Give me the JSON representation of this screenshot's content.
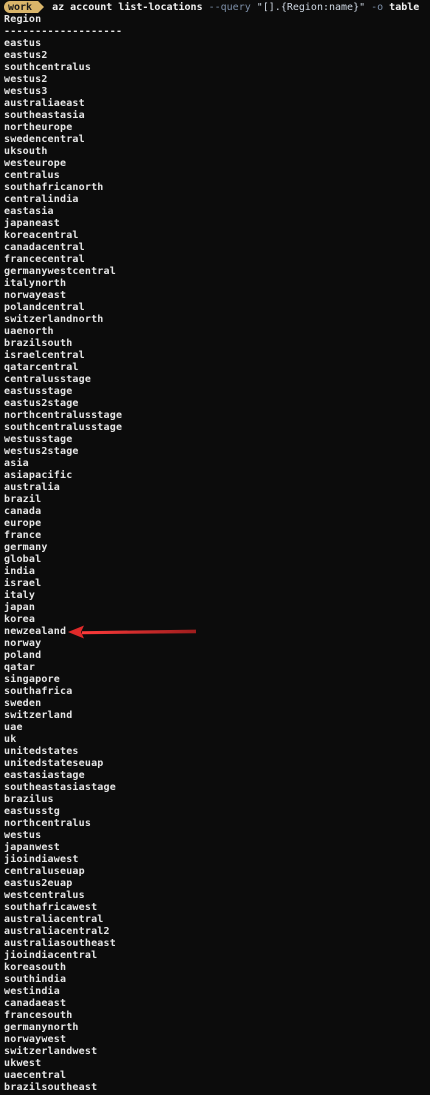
{
  "prompt": {
    "badge": "work",
    "command": "az",
    "args": [
      "account",
      "list-locations"
    ],
    "query_flag": "--query",
    "query_value": "\"[].{Region:name}\"",
    "output_flag": "-o",
    "output_value": "table"
  },
  "table": {
    "header": "Region",
    "separator": "-------------------",
    "rows": [
      "eastus",
      "eastus2",
      "southcentralus",
      "westus2",
      "westus3",
      "australiaeast",
      "southeastasia",
      "northeurope",
      "swedencentral",
      "uksouth",
      "westeurope",
      "centralus",
      "southafricanorth",
      "centralindia",
      "eastasia",
      "japaneast",
      "koreacentral",
      "canadacentral",
      "francecentral",
      "germanywestcentral",
      "italynorth",
      "norwayeast",
      "polandcentral",
      "switzerlandnorth",
      "uaenorth",
      "brazilsouth",
      "israelcentral",
      "qatarcentral",
      "centralusstage",
      "eastusstage",
      "eastus2stage",
      "northcentralusstage",
      "southcentralusstage",
      "westusstage",
      "westus2stage",
      "asia",
      "asiapacific",
      "australia",
      "brazil",
      "canada",
      "europe",
      "france",
      "germany",
      "global",
      "india",
      "israel",
      "italy",
      "japan",
      "korea",
      "newzealand",
      "norway",
      "poland",
      "qatar",
      "singapore",
      "southafrica",
      "sweden",
      "switzerland",
      "uae",
      "uk",
      "unitedstates",
      "unitedstateseuap",
      "eastasiastage",
      "southeastasiastage",
      "brazilus",
      "eastusstg",
      "northcentralus",
      "westus",
      "japanwest",
      "jioindiawest",
      "centraluseuap",
      "eastus2euap",
      "westcentralus",
      "southafricawest",
      "australiacentral",
      "australiacentral2",
      "australiasoutheast",
      "jioindiacentral",
      "koreasouth",
      "southindia",
      "westindia",
      "canadaeast",
      "francesouth",
      "germanynorth",
      "norwaywest",
      "switzerlandwest",
      "ukwest",
      "uaecentral",
      "brazilsoutheast"
    ]
  },
  "annotation": {
    "highlighted_row": "newzealand",
    "arrow_color": "#d42a2a"
  },
  "colors": {
    "background": "#0c0c0c",
    "text": "#e6e6e6",
    "badge": "#d9b56a",
    "flag": "#7d8fa8"
  }
}
